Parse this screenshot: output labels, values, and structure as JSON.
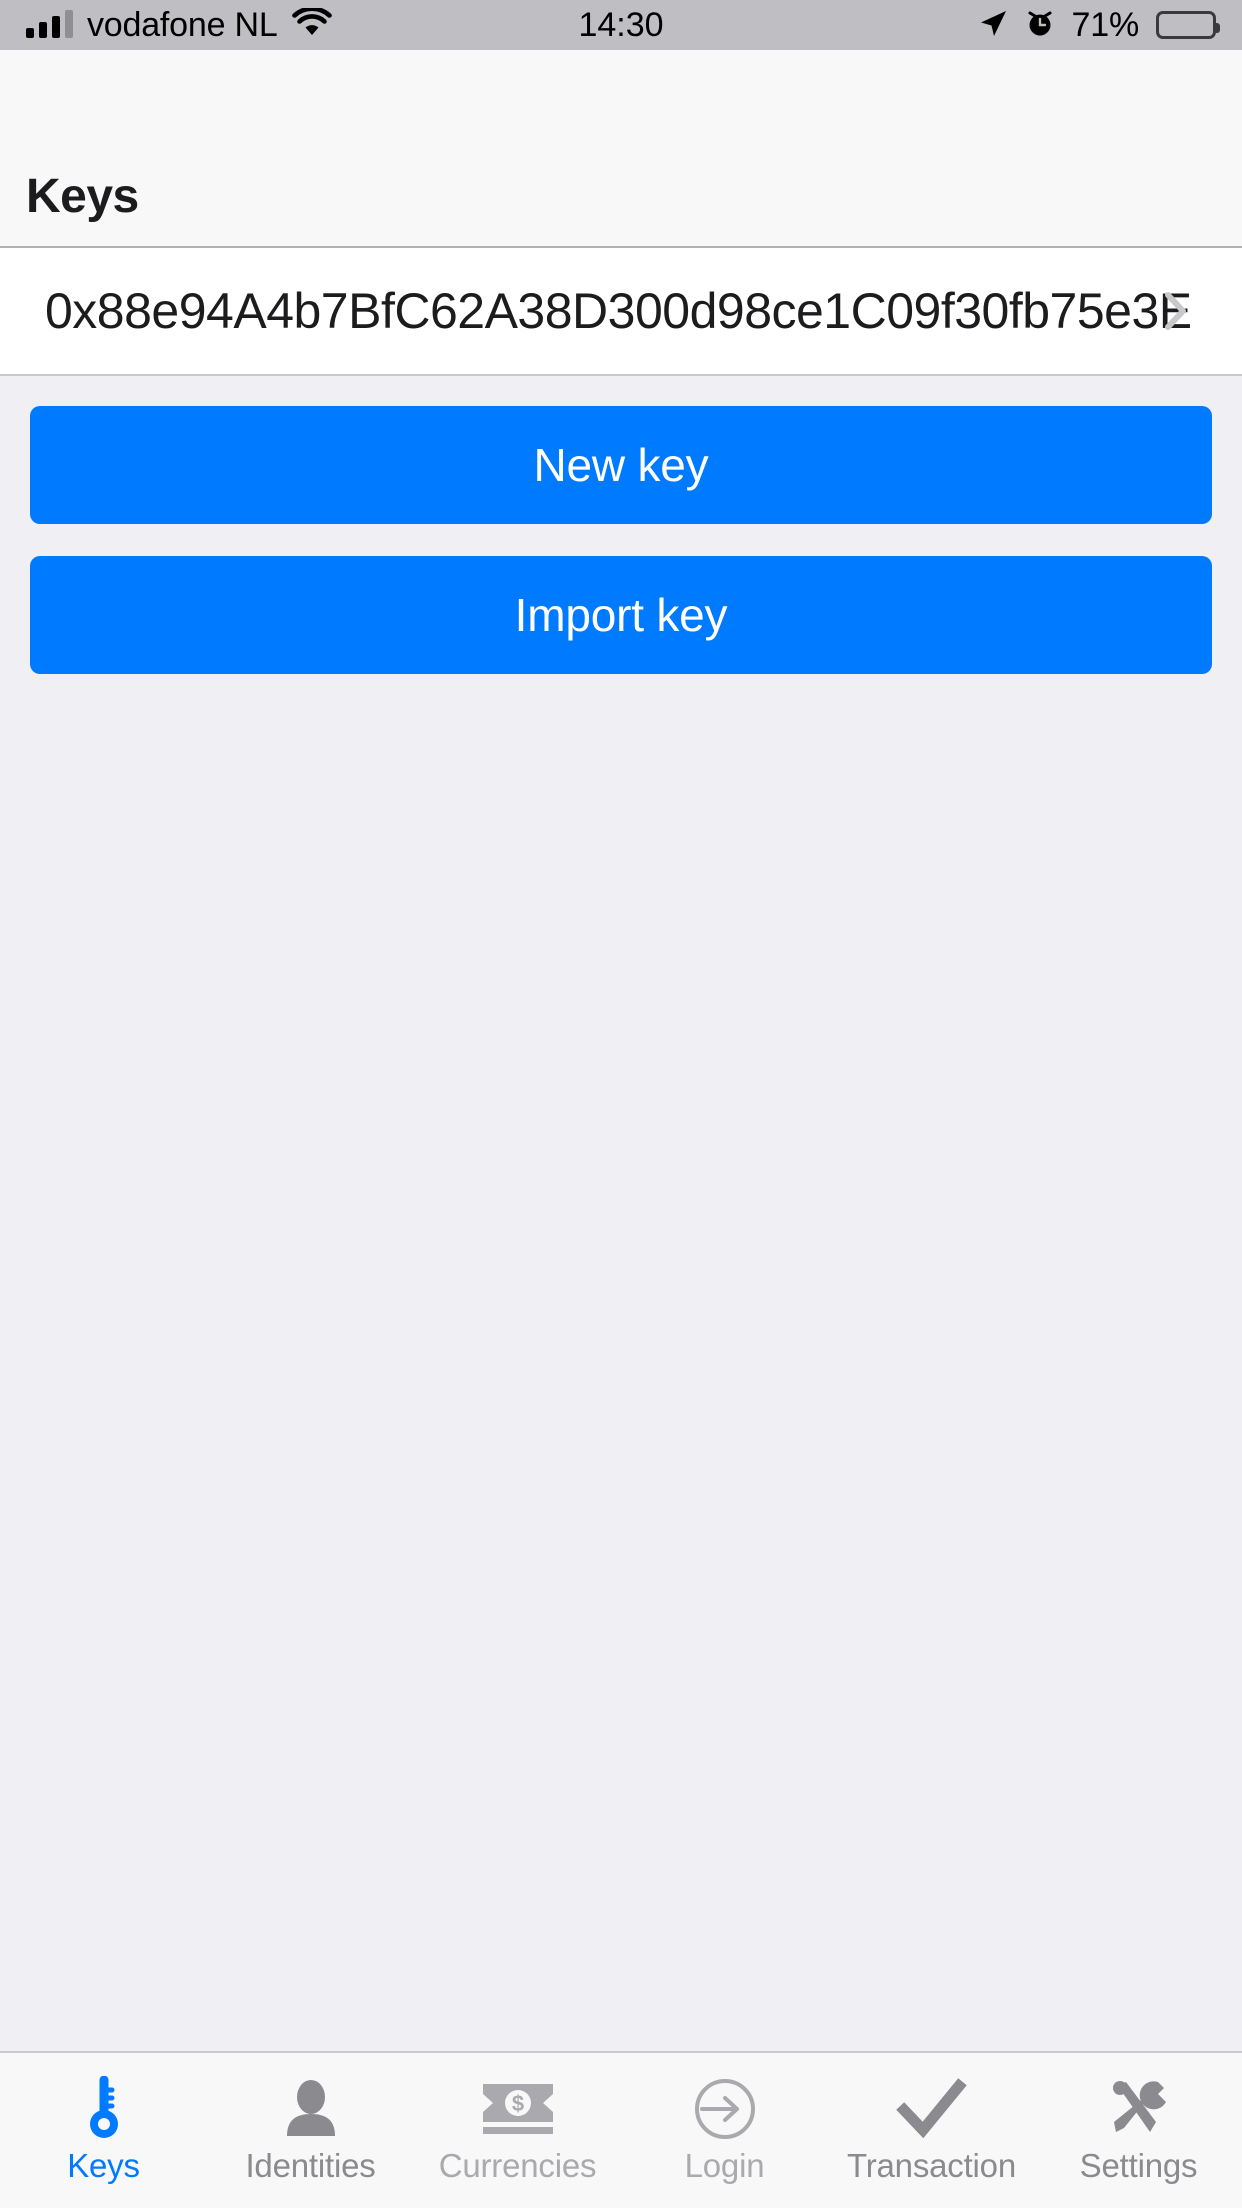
{
  "status_bar": {
    "carrier": "vodafone NL",
    "signal_icon": "signal-bars-icon",
    "signal_bars_filled": 3,
    "signal_bars_total": 4,
    "wifi_icon": "wifi-icon",
    "time": "14:30",
    "location_icon": "location-arrow-icon",
    "alarm_icon": "alarm-clock-icon",
    "battery_percent": "71%",
    "battery_level": 71,
    "battery_icon": "battery-icon",
    "background_color": "#BEBEC3"
  },
  "header": {
    "title": "Keys",
    "background_color": "#F8F8F8"
  },
  "key_list": {
    "rows": [
      {
        "address": "0x88e94A4b7BfC62A38D300d98ce1C09f30fb75e3E",
        "disclosure_icon": "chevron-right-icon"
      }
    ]
  },
  "actions": {
    "new_key_label": "New key",
    "import_key_label": "Import key",
    "accent_color": "#007AFF"
  },
  "content": {
    "background_color": "#EFEFF4"
  },
  "tab_bar": {
    "active_color": "#007AFF",
    "inactive_color": "#8A8A8F",
    "disabled_color": "#A9A9AE",
    "items": [
      {
        "label": "Keys",
        "icon": "key-icon",
        "state": "active"
      },
      {
        "label": "Identities",
        "icon": "person-icon",
        "state": "normal"
      },
      {
        "label": "Currencies",
        "icon": "banknote-icon",
        "state": "disabled"
      },
      {
        "label": "Login",
        "icon": "login-arrow-icon",
        "state": "disabled"
      },
      {
        "label": "Transaction",
        "icon": "checkmark-icon",
        "state": "normal"
      },
      {
        "label": "Settings",
        "icon": "tools-icon",
        "state": "normal"
      }
    ]
  }
}
